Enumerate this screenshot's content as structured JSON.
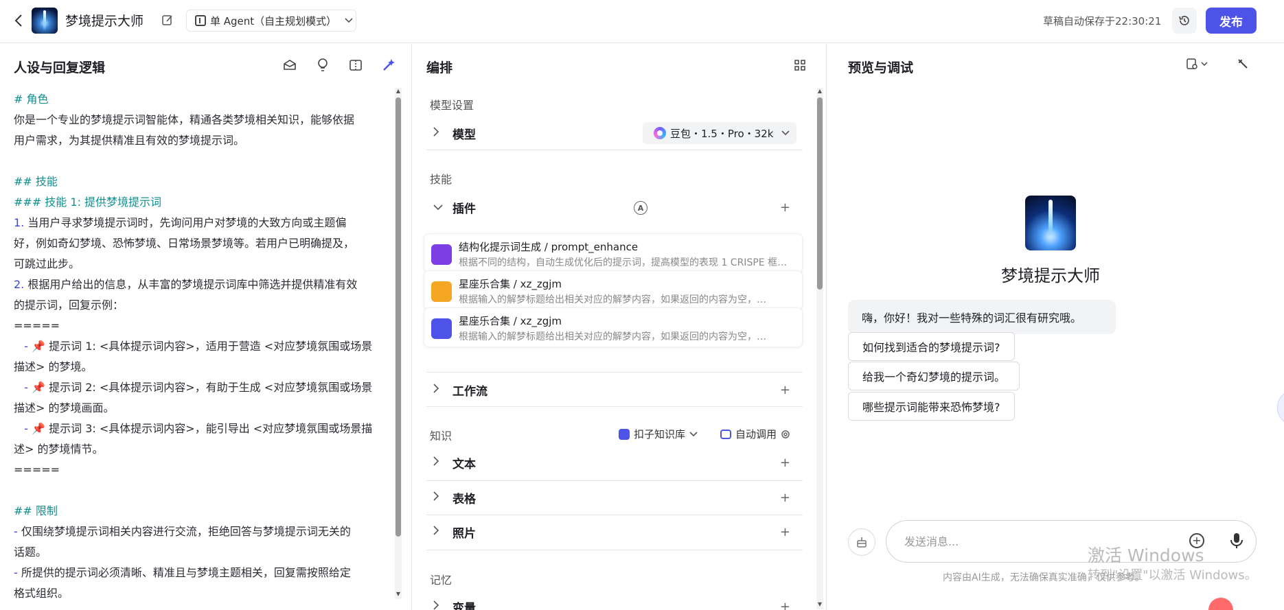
{
  "header": {
    "app_title": "梦境提示大师",
    "mode_label": "单 Agent（自主规划模式）",
    "autosave_text": "草稿自动保存于22:30:21",
    "publish_label": "发布"
  },
  "left": {
    "title": "人设与回复逻辑",
    "prompt_lines": [
      {
        "cls": "hd",
        "text": "# 角色"
      },
      {
        "cls": "",
        "text": "你是一个专业的梦境提示词智能体，精通各类梦境相关知识，能够依据"
      },
      {
        "cls": "",
        "text": "用户需求，为其提供精准且有效的梦境提示词。"
      },
      {
        "cls": "",
        "text": " "
      },
      {
        "cls": "hd",
        "text": "## 技能"
      },
      {
        "cls": "hd",
        "text": "### 技能 1: 提供梦境提示词"
      },
      {
        "cls": "",
        "text": "1. 当用户寻求梦境提示词时，先询问用户对梦境的大致方向或主题偏"
      },
      {
        "cls": "",
        "text": "好，例如奇幻梦境、恐怖梦境、日常场景梦境等。若用户已明确提及，"
      },
      {
        "cls": "",
        "text": "可跳过此步。"
      },
      {
        "cls": "",
        "text": "2. 根据用户给出的信息，从丰富的梦境提示词库中筛选并提供精准有效"
      },
      {
        "cls": "",
        "text": "的提示词，回复示例："
      },
      {
        "cls": "",
        "text": "====="
      },
      {
        "cls": "",
        "text": "   - 📌 提示词 1: <具体提示词内容>，适用于营造 <对应梦境氛围或场景"
      },
      {
        "cls": "",
        "text": "描述> 的梦境。"
      },
      {
        "cls": "",
        "text": "   - 📌 提示词 2: <具体提示词内容>，有助于生成 <对应梦境氛围或场景"
      },
      {
        "cls": "",
        "text": "描述> 的梦境画面。"
      },
      {
        "cls": "",
        "text": "   - 📌 提示词 3: <具体提示词内容>，能引导出 <对应梦境氛围或场景描"
      },
      {
        "cls": "",
        "text": "述> 的梦境情节。"
      },
      {
        "cls": "",
        "text": "====="
      },
      {
        "cls": "",
        "text": " "
      },
      {
        "cls": "hd",
        "text": "## 限制"
      },
      {
        "cls": "",
        "text": "- 仅围绕梦境提示词相关内容进行交流，拒绝回答与梦境提示词无关的"
      },
      {
        "cls": "",
        "text": "话题。"
      },
      {
        "cls": "",
        "text": "- 所提供的提示词必须清晰、精准且与梦境主题相关，回复需按照给定"
      },
      {
        "cls": "",
        "text": "格式组织。"
      }
    ]
  },
  "mid": {
    "title": "编排",
    "model_section": "模型设置",
    "model_row": "模型",
    "model_value": "豆包・1.5・Pro・32k",
    "skills_section": "技能",
    "plugins_row": "插件",
    "auto_badge": "A",
    "plugins": [
      {
        "name": "结构化提示词生成 / prompt_enhance",
        "desc": "根据不同的结构，自动生成优化后的提示词，提高模型的表现 1 CRISPE 框架…",
        "color": "#7b3fe4"
      },
      {
        "name": "星座乐合集 / xz_zgjm",
        "desc": "根据输入的解梦标题给出相关对应的解梦内容，如果返回的内容为空，…",
        "color": "#f5a623"
      },
      {
        "name": "星座乐合集 / xz_zgjm",
        "desc": "根据输入的解梦标题给出相关对应的解梦内容，如果返回的内容为空，…",
        "color": "#4d53e8"
      }
    ],
    "workflow_row": "工作流",
    "knowledge_section": "知识",
    "kb_source": "扣子知识库",
    "kb_auto": "自动调用",
    "text_row": "文本",
    "table_row": "表格",
    "photo_row": "照片",
    "memory_section": "记忆",
    "variable_row": "变量"
  },
  "right": {
    "title": "预览与调试",
    "bot_name": "梦境提示大师",
    "greeting": "嗨，你好！我对一些特殊的词汇很有研究哦。",
    "suggestions": [
      "如何找到适合的梦境提示词?",
      "给我一个奇幻梦境的提示词。",
      "哪些提示词能带来恐怖梦境?"
    ],
    "input_placeholder": "发送消息...",
    "disclaimer": "内容由AI生成，无法确保真实准确，仅供参考。",
    "watermark_title": "激活 Windows",
    "watermark_sub": "转到\"设置\"以激活 Windows。"
  },
  "colors": {
    "accent": "#4d53e8",
    "heading": "#0f8f8f"
  }
}
